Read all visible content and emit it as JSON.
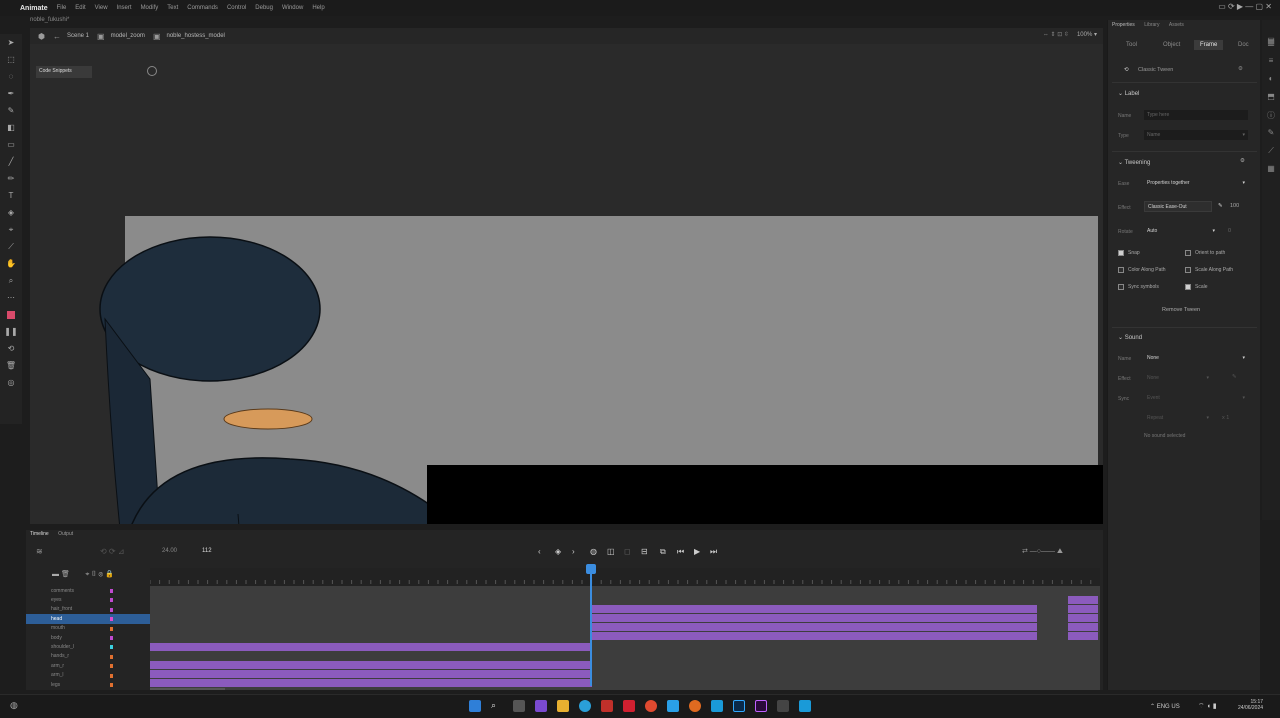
{
  "app": {
    "name": "Animate",
    "menu": [
      "File",
      "Edit",
      "View",
      "Insert",
      "Modify",
      "Text",
      "Commands",
      "Control",
      "Debug",
      "Window",
      "Help"
    ],
    "doc_tab": "noble_fukushi*"
  },
  "editbar": {
    "crumbs": [
      "Scene 1",
      "model_zoom",
      "noble_hostess_model"
    ],
    "zoom": "100%"
  },
  "stage": {
    "code_snippets": "Code Snippets",
    "colors": {
      "pasteboard": "#2a2a2a",
      "stage": "#8b8b8b",
      "hair": "#1e2d3c",
      "skin": "#d79a5a"
    }
  },
  "properties": {
    "header_tabs": [
      "Properties",
      "Library",
      "Assets"
    ],
    "tabs": [
      "Tool",
      "Object",
      "Frame",
      "Doc"
    ],
    "active_tab": "Frame",
    "tween_type": "Classic Tween",
    "label_section": "Label",
    "name_label": "Name",
    "name_placeholder": "Type here",
    "type_label": "Type",
    "type_value": "Name",
    "tweening_section": "Tweening",
    "ease_label": "Ease",
    "ease_value": "Properties together",
    "effect_label": "Effect",
    "effect_value": "Classic Ease-Out",
    "effect_amount": "100",
    "rotate_label": "Rotate",
    "rotate_value": "Auto",
    "rotate_count": "0",
    "snap": "Snap",
    "orient_to_path": "Orient to path",
    "color_along_path": "Color Along Path",
    "scale_along_path": "Scale Along Path",
    "sync_symbols": "Sync symbols",
    "scale": "Scale",
    "remove_tween": "Remove Tween",
    "sound_section": "Sound",
    "sound_name_label": "Name",
    "sound_name_value": "None",
    "effect2_label": "Effect",
    "effect2_value": "None",
    "sync_label": "Sync",
    "sync_value": "Event",
    "repeat_value": "Repeat",
    "repeat_count": "x 1",
    "no_sound": "No sound selected"
  },
  "timeline": {
    "tabs": [
      "Timeline",
      "Output"
    ],
    "fps": "24.00",
    "frame": "112",
    "layers": [
      "comments",
      "eyes",
      "hair_front",
      "head",
      "mouth",
      "body",
      "shoulder_l",
      "hands_r",
      "arm_r",
      "arm_l",
      "legs"
    ],
    "selected_layer": 3,
    "tween_color": "#8b5bbd",
    "playhead_color": "#3b8de0"
  },
  "taskbar": {
    "lang": "ENG",
    "region": "US",
    "time": "15:17",
    "date": "24/06/2024"
  }
}
